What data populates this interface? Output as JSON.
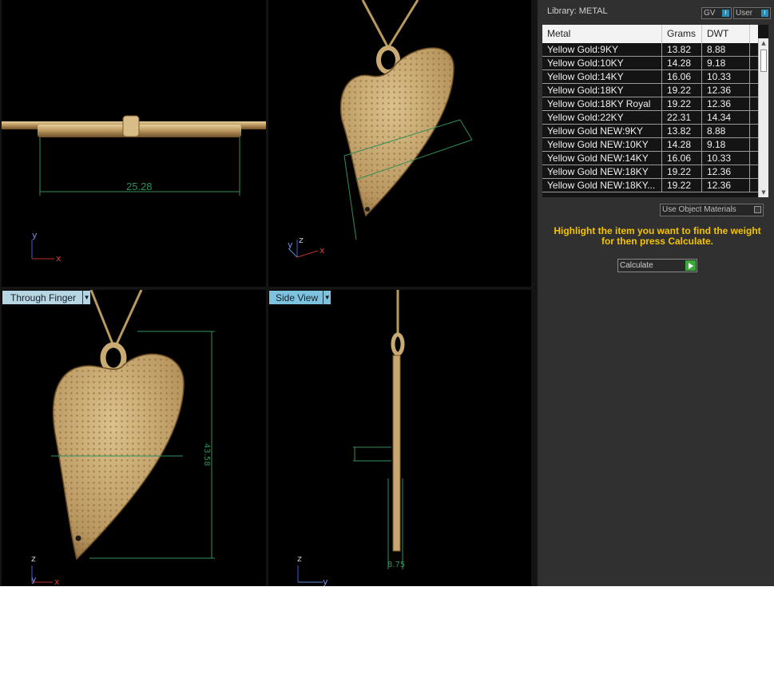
{
  "viewports": {
    "top_left": {
      "dimension": "25.28",
      "axis_labels": [
        "y",
        "x"
      ]
    },
    "top_right": {
      "axis_labels": [
        "z",
        "y",
        "x"
      ]
    },
    "bottom_left": {
      "label": "Through Finger",
      "dimension": "43.58",
      "axis_labels": [
        "z",
        "y",
        "x"
      ]
    },
    "bottom_right": {
      "label": "Side View",
      "dimension": "8.75",
      "axis_labels": [
        "z",
        "y"
      ]
    }
  },
  "panel": {
    "library_label": "Library: METAL",
    "toggle_gv": "GV",
    "toggle_user": "User",
    "columns": [
      "Metal",
      "Grams",
      "DWT"
    ],
    "rows": [
      [
        "Yellow Gold:9KY",
        "13.82",
        "8.88"
      ],
      [
        "Yellow Gold:10KY",
        "14.28",
        "9.18"
      ],
      [
        "Yellow Gold:14KY",
        "16.06",
        "10.33"
      ],
      [
        "Yellow Gold:18KY",
        "19.22",
        "12.36"
      ],
      [
        "Yellow Gold:18KY Royal",
        "19.22",
        "12.36"
      ],
      [
        "Yellow Gold:22KY",
        "22.31",
        "14.34"
      ],
      [
        "Yellow Gold NEW:9KY",
        "13.82",
        "8.88"
      ],
      [
        "Yellow Gold NEW:10KY",
        "14.28",
        "9.18"
      ],
      [
        "Yellow Gold NEW:14KY",
        "16.06",
        "10.33"
      ],
      [
        "Yellow Gold NEW:18KY",
        "19.22",
        "12.36"
      ],
      [
        "Yellow Gold NEW:18KY...",
        "19.22",
        "12.36"
      ]
    ],
    "use_object_materials": "Use Object Materials",
    "hint": "Highlight the item you want to find the weight for then press Calculate.",
    "calculate_label": "Calculate"
  },
  "colors": {
    "gold": "#c8a772",
    "gold_dark": "#8a6b3c",
    "dimension_green": "#2f8f5a",
    "hint_yellow": "#f5c400",
    "viewport_border": "#7fa9c1"
  }
}
